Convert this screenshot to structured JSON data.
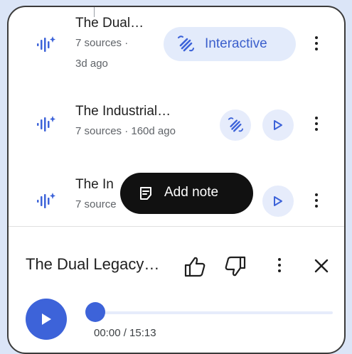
{
  "colors": {
    "accent": "#3d63d9",
    "pill_bg": "#e3ebfb",
    "toast_bg": "#111111"
  },
  "items": [
    {
      "title": "The Dual…",
      "subtitle_line1": "7 sources ·",
      "subtitle_line2": "3d ago",
      "action_label": "Interactive",
      "action_icon": "interactive-hand-icon"
    },
    {
      "title": "The Industrial…",
      "subtitle": "7 sources · 160d ago",
      "actions": [
        "interactive-hand-icon",
        "play-icon"
      ]
    },
    {
      "title": "The In",
      "subtitle": "7 source",
      "actions": [
        "play-icon"
      ]
    }
  ],
  "toast": {
    "label": "Add note",
    "icon": "note-icon"
  },
  "player": {
    "title": "The Dual Legacy…",
    "time": "00:00 / 15:13",
    "progress": 0,
    "icons": [
      "thumbs-up-icon",
      "thumbs-down-icon",
      "more-vert-icon",
      "close-icon",
      "play-icon"
    ]
  }
}
